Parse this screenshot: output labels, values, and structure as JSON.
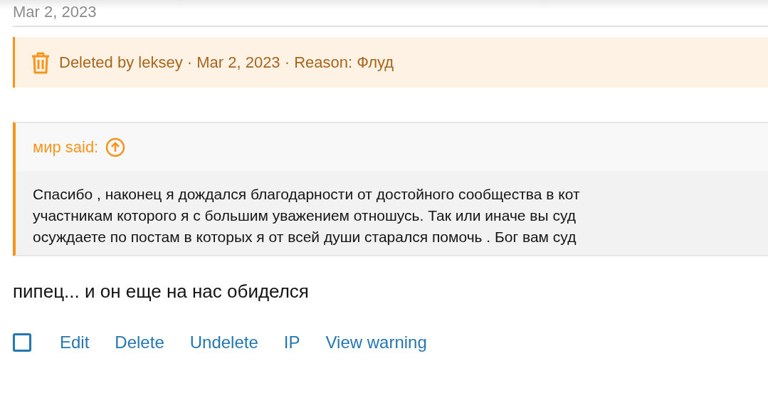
{
  "date": "Mar 2, 2023",
  "deleted_notice": {
    "text": "Deleted by leksey · Mar 2, 2023 · Reason: Флуд"
  },
  "quote": {
    "author": "мир said:",
    "lines": [
      "Спасибо , наконец я дождался благодарности от достойного сообщества в кот",
      "участникам которого я с большим уважением отношусь. Так или иначе вы суд",
      "осуждаете по постам в которых я от всей души старался помочь . Бог вам суд"
    ]
  },
  "message": "пипец... и он еще на нас обиделся",
  "select_checkbox": {
    "checked": false
  },
  "actions": [
    "Edit",
    "Delete",
    "Undelete",
    "IP",
    "View warning"
  ]
}
